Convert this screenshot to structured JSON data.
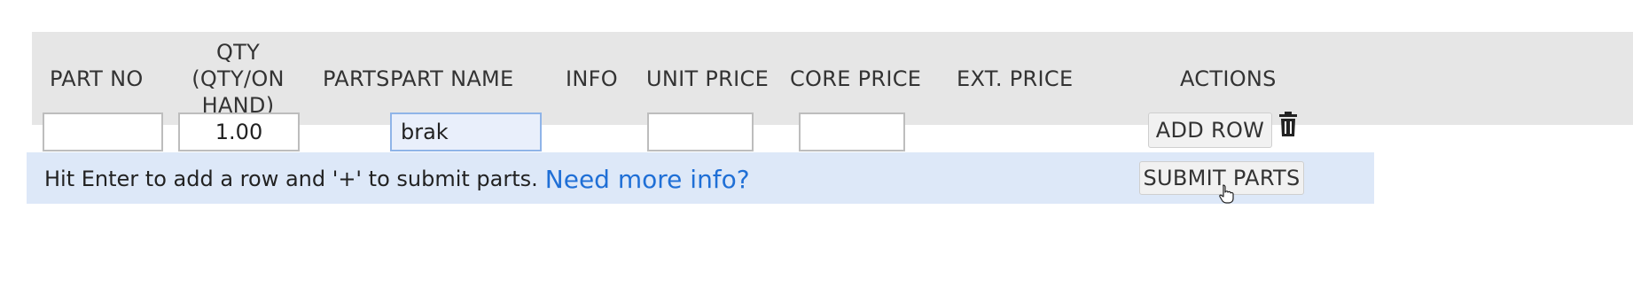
{
  "table": {
    "columns": [
      {
        "id": "part-no",
        "label": "PART NO"
      },
      {
        "id": "qty",
        "label": "QTY (QTY/ON HAND)"
      },
      {
        "id": "parts",
        "label": "PARTS"
      },
      {
        "id": "part-name",
        "label": "PART NAME"
      },
      {
        "id": "info",
        "label": "INFO"
      },
      {
        "id": "unit-price",
        "label": "UNIT PRICE"
      },
      {
        "id": "core-price",
        "label": "CORE PRICE"
      },
      {
        "id": "ext-price",
        "label": "EXT. PRICE"
      },
      {
        "id": "actions",
        "label": "ACTIONS"
      }
    ],
    "qty_line1": "QTY (QTY/ON",
    "qty_line2": "HAND)"
  },
  "row": {
    "part_no_value": "",
    "qty_value": "1.00",
    "part_name_value": "brak",
    "unit_price_value": "",
    "core_price_value": "",
    "add_row_label": "ADD ROW"
  },
  "footer": {
    "hint_text": "Hit Enter to add a row and '+' to submit parts.",
    "more_info_link": "Need more info?",
    "submit_label": "SUBMIT PARTS"
  },
  "colors": {
    "header_bg": "#e6e6e6",
    "info_bg": "#dde8f8",
    "link": "#1f6fd6",
    "focused_input_bg": "#e9effb"
  },
  "icons": [
    "trash-icon",
    "hand-pointer-icon"
  ]
}
